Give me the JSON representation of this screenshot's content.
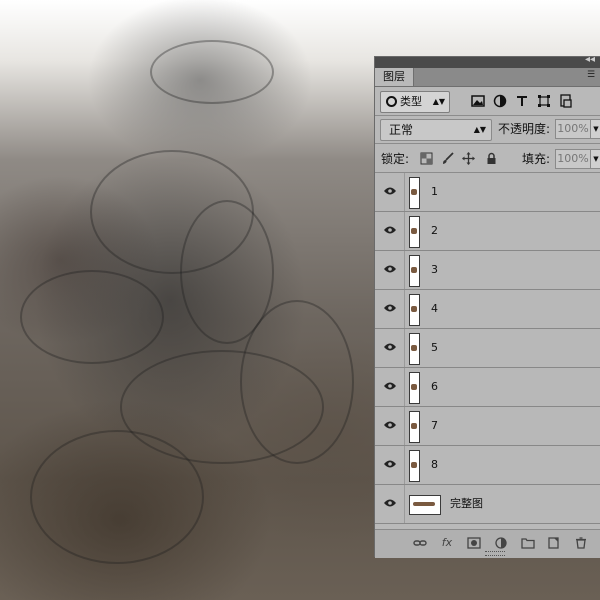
{
  "panel": {
    "tab_label": "图层",
    "filter": {
      "label": "类型"
    },
    "blend_mode": "正常",
    "opacity_label": "不透明度:",
    "opacity_value": "100%",
    "lock_label": "锁定:",
    "fill_label": "填充:",
    "fill_value": "100%",
    "layers": [
      {
        "name": "1"
      },
      {
        "name": "2"
      },
      {
        "name": "3"
      },
      {
        "name": "4"
      },
      {
        "name": "5"
      },
      {
        "name": "6"
      },
      {
        "name": "7"
      },
      {
        "name": "8"
      },
      {
        "name": "完整图"
      }
    ],
    "bottom_icons": [
      "link-icon",
      "fx-icon",
      "mask-icon",
      "adjustment-icon",
      "folder-icon",
      "new-layer-icon",
      "trash-icon"
    ],
    "fx_label": "fx"
  },
  "colors": {
    "panel_bg": "#b9b9b9",
    "panel_header": "#4a4a4a"
  }
}
